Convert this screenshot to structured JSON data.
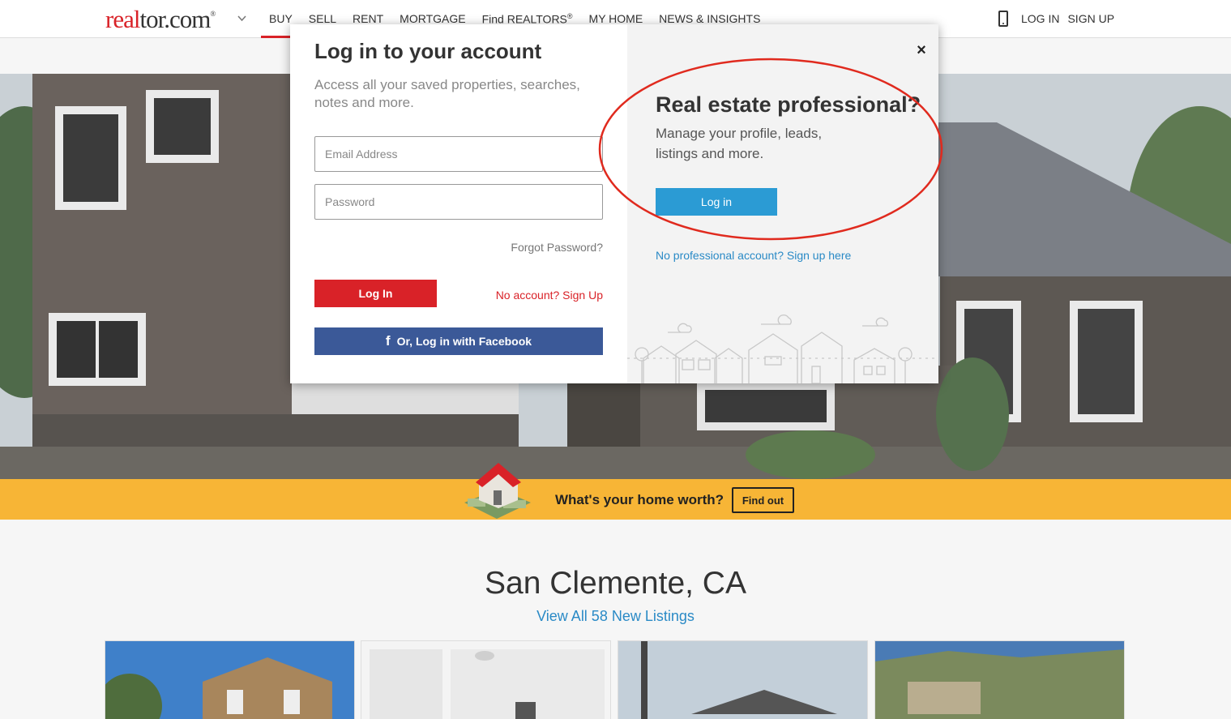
{
  "header": {
    "logo_red": "real",
    "logo_rest": "tor.com",
    "logo_mark": "®",
    "nav": [
      {
        "label": "BUY"
      },
      {
        "label": "SELL"
      },
      {
        "label": "RENT"
      },
      {
        "label": "MORTGAGE"
      },
      {
        "label": "Find REALTORS",
        "sup": "®"
      },
      {
        "label": "MY HOME"
      },
      {
        "label": "NEWS & INSIGHTS"
      }
    ],
    "login": "LOG IN",
    "signup": "SIGN UP"
  },
  "banner": {
    "question": "What's your home worth?",
    "button": "Find out"
  },
  "listings": {
    "city": "San Clemente, CA",
    "view_all": "View All 58 New Listings"
  },
  "modal": {
    "title": "Log in to your account",
    "subtitle": "Access all your saved properties, searches, notes and more.",
    "email_placeholder": "Email Address",
    "password_placeholder": "Password",
    "forgot": "Forgot Password?",
    "login_button": "Log In",
    "no_account": "No account? Sign Up",
    "facebook_button": "Or, Log in with Facebook",
    "facebook_icon": "f",
    "close": "×",
    "pro": {
      "title": "Real estate professional?",
      "subtitle": "Manage your profile, leads, listings and more.",
      "login_button": "Log in",
      "signup": "No professional account? Sign up here"
    }
  },
  "colors": {
    "brand_red": "#d92228",
    "pro_blue": "#2b9bd4",
    "facebook_blue": "#3b5998",
    "banner_yellow": "#f7b536",
    "link_blue": "#2a8ac6"
  }
}
